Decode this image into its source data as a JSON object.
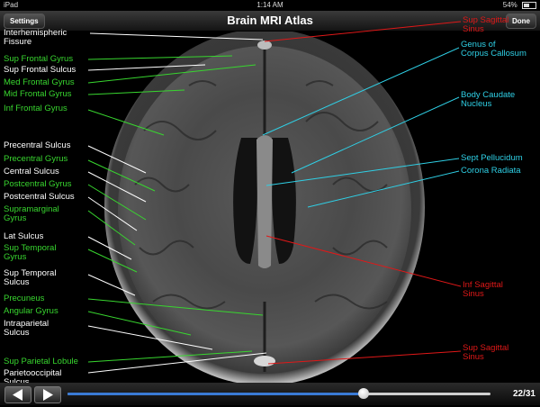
{
  "statusbar": {
    "device": "iPad",
    "time": "1:14 AM",
    "battery": "54%"
  },
  "battery_level": 0.54,
  "navbar": {
    "title": "Brain MRI Atlas",
    "settings_label": "Settings",
    "done_label": "Done"
  },
  "labels": [
    {
      "id": "interhemispheric-fissure",
      "text": "Interhemispheric\nFissure",
      "color": "white"
    },
    {
      "id": "sup-frontal-gyrus",
      "text": "Sup Frontal Gyrus",
      "color": "green"
    },
    {
      "id": "sup-frontal-sulcus",
      "text": "Sup Frontal Sulcus",
      "color": "white"
    },
    {
      "id": "med-frontal-gyrus",
      "text": "Med Frontal Gyrus",
      "color": "green"
    },
    {
      "id": "mid-frontal-gyrus",
      "text": "Mid Frontal Gyrus",
      "color": "green"
    },
    {
      "id": "inf-frontal-gyrus",
      "text": "Inf Frontal Gyrus",
      "color": "green"
    },
    {
      "id": "precentral-sulcus",
      "text": "Precentral Sulcus",
      "color": "white"
    },
    {
      "id": "precentral-gyrus",
      "text": "Precentral Gyrus",
      "color": "green"
    },
    {
      "id": "central-sulcus",
      "text": "Central Sulcus",
      "color": "white"
    },
    {
      "id": "postcentral-gyrus",
      "text": "Postcentral Gyrus",
      "color": "green"
    },
    {
      "id": "postcentral-sulcus",
      "text": "Postcentral Sulcus",
      "color": "white"
    },
    {
      "id": "supramarginal-gyrus",
      "text": "Supramarginal\nGyrus",
      "color": "green"
    },
    {
      "id": "lat-sulcus",
      "text": "Lat Sulcus",
      "color": "white"
    },
    {
      "id": "sup-temporal-gyrus",
      "text": "Sup Temporal\nGyrus",
      "color": "green"
    },
    {
      "id": "sup-temporal-sulcus",
      "text": "Sup Temporal\nSulcus",
      "color": "white"
    },
    {
      "id": "precuneus",
      "text": "Precuneus",
      "color": "green"
    },
    {
      "id": "angular-gyrus",
      "text": "Angular Gyrus",
      "color": "green"
    },
    {
      "id": "intraparietal-sulcus",
      "text": "Intraparietal\nSulcus",
      "color": "white"
    },
    {
      "id": "sup-parietal-lobule",
      "text": "Sup Parietal Lobule",
      "color": "green"
    },
    {
      "id": "parietooccipital-sulcus",
      "text": "Parietooccipital\nSulcus",
      "color": "white"
    },
    {
      "id": "sup-sagittal-sinus-top",
      "text": "Sup Sagittal\nSinus",
      "color": "red"
    },
    {
      "id": "genus-corpus-callosum",
      "text": "Genus of\nCorpus Callosum",
      "color": "cyan"
    },
    {
      "id": "body-caudate-nucleus",
      "text": "Body Caudate\nNucleus",
      "color": "cyan"
    },
    {
      "id": "sept-pellucidum",
      "text": "Sept Pellucidum",
      "color": "cyan"
    },
    {
      "id": "corona-radiata",
      "text": "Corona Radiata",
      "color": "cyan"
    },
    {
      "id": "inf-sagittal-sinus",
      "text": "Inf Sagittal\nSinus",
      "color": "red"
    },
    {
      "id": "sup-sagittal-sinus-bottom",
      "text": "Sup Sagittal\nSinus",
      "color": "red"
    }
  ],
  "colors": {
    "white": "#ffffff",
    "green": "#38d62f",
    "cyan": "#2fd0e6",
    "red": "#e01818",
    "slider_fill": "#3a7bd5"
  },
  "pager": {
    "page_text": "22/31",
    "current": 22,
    "total": 31
  },
  "icons": {
    "prev": "left-arrow-icon",
    "next": "right-arrow-icon"
  }
}
